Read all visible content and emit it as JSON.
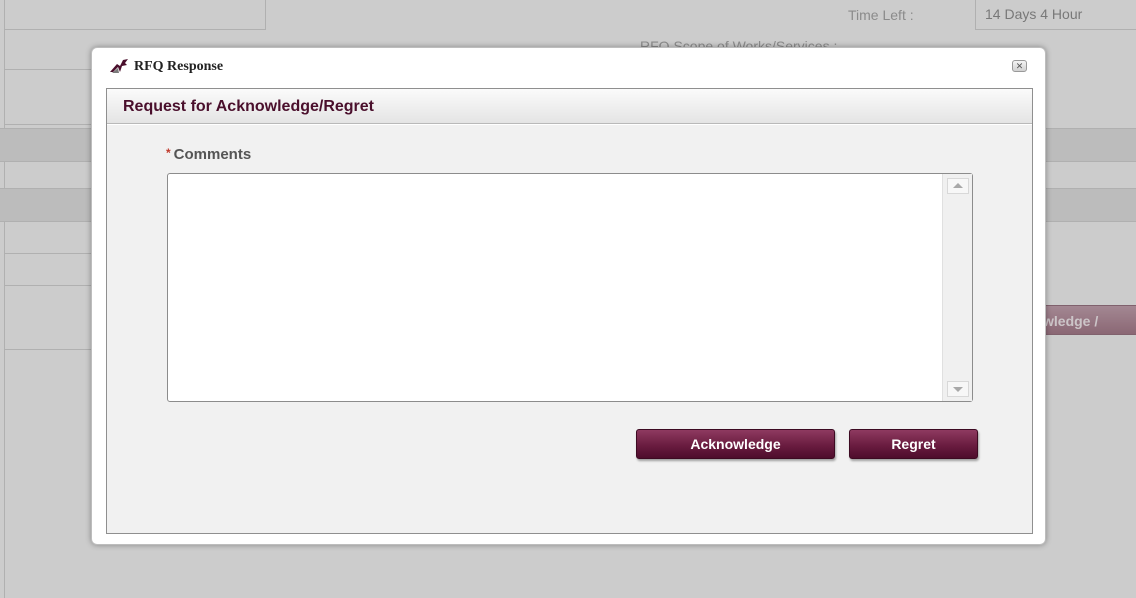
{
  "background": {
    "time_left_label": "Time Left :",
    "time_left_value": "14 Days 4 Hour",
    "scope_label": "RFQ Scope of Works/Services :",
    "partial_button_label": "wledge /"
  },
  "dialog": {
    "title": "RFQ Response",
    "close_label": "✕",
    "panel_title": "Request for Acknowledge/Regret",
    "comments": {
      "label": "Comments",
      "required_mark": "*",
      "value": ""
    },
    "buttons": {
      "acknowledge": "Acknowledge",
      "regret": "Regret"
    }
  },
  "colors": {
    "brand_maroon": "#6a1c40",
    "panel_title": "#4a0f2c",
    "required": "#c0392b"
  }
}
